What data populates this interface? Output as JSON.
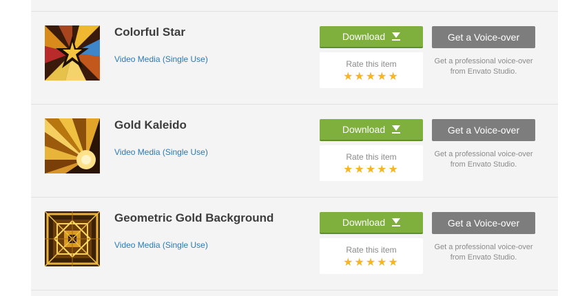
{
  "items": [
    {
      "title": "Colorful Star",
      "license": "Video Media (Single Use)",
      "download_label": "Download",
      "rate_label": "Rate this item",
      "stars": "★★★★★",
      "voiceover_label": "Get a Voice-over",
      "voiceover_text": "Get a professional voice-over from Envato Studio.",
      "thumb_icon": "colorful-star-thumbnail"
    },
    {
      "title": "Gold Kaleido",
      "license": "Video Media (Single Use)",
      "download_label": "Download",
      "rate_label": "Rate this item",
      "stars": "★★★★★",
      "voiceover_label": "Get a Voice-over",
      "voiceover_text": "Get a professional voice-over from Envato Studio.",
      "thumb_icon": "gold-kaleido-thumbnail"
    },
    {
      "title": "Geometric Gold Background",
      "license": "Video Media (Single Use)",
      "download_label": "Download",
      "rate_label": "Rate this item",
      "stars": "★★★★★",
      "voiceover_label": "Get a Voice-over",
      "voiceover_text": "Get a professional voice-over from Envato Studio.",
      "thumb_icon": "geometric-gold-thumbnail"
    }
  ],
  "colors": {
    "download_green": "#7fb03e",
    "voiceover_gray": "#7d7d7d",
    "star_gold": "#f6b523",
    "link_blue": "#2a7ab5"
  }
}
